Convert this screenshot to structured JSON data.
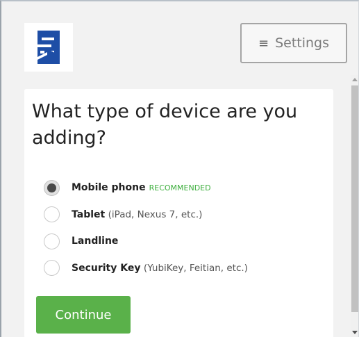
{
  "header": {
    "logo_icon": "duo-building-logo-icon",
    "settings_icon": "hamburger-menu-icon",
    "settings_icon_glyph": "≡",
    "settings_label": "Settings"
  },
  "main": {
    "title": "What type of device are you adding?",
    "options": [
      {
        "label": "Mobile phone",
        "note": "",
        "badge": "RECOMMENDED",
        "selected": true
      },
      {
        "label": "Tablet",
        "note": "(iPad, Nexus 7, etc.)",
        "badge": "",
        "selected": false
      },
      {
        "label": "Landline",
        "note": "",
        "badge": "",
        "selected": false
      },
      {
        "label": "Security Key",
        "note": "(YubiKey, Feitian, etc.)",
        "badge": "",
        "selected": false
      }
    ],
    "continue_label": "Continue"
  },
  "colors": {
    "logo_blue": "#1e4ea6",
    "accent_green": "#5ab14a",
    "badge_green": "#3cae3c"
  }
}
